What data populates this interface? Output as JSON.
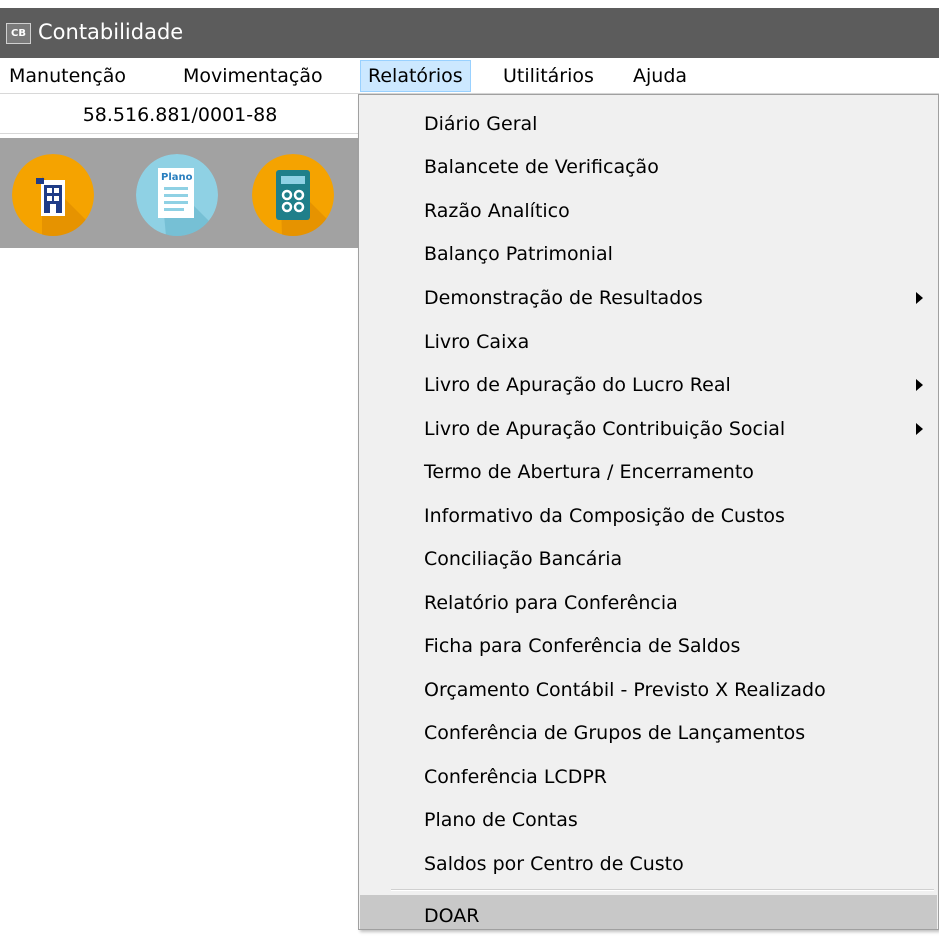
{
  "window": {
    "title": "Contabilidade",
    "icon_text": "CB"
  },
  "menubar": {
    "items": [
      "Manutenção",
      "Movimentação",
      "Relatórios",
      "Utilitários",
      "Ajuda"
    ],
    "active": "Relatórios"
  },
  "company": {
    "cnpj": "58.516.881/0001-88"
  },
  "toolbar": {
    "buttons": [
      {
        "icon": "building-icon",
        "accent": "#f5a300"
      },
      {
        "icon": "plano-document-icon",
        "label": "Plano",
        "accent": "#8fd1e4"
      },
      {
        "icon": "calculator-icon",
        "accent": "#f5a300"
      }
    ]
  },
  "relatorios_menu": {
    "items": [
      {
        "label": "Diário Geral"
      },
      {
        "label": "Balancete de Verificação"
      },
      {
        "label": "Razão Analítico"
      },
      {
        "label": "Balanço Patrimonial"
      },
      {
        "label": "Demonstração de Resultados",
        "submenu": true
      },
      {
        "label": "Livro Caixa"
      },
      {
        "label": "Livro de Apuração do Lucro Real",
        "submenu": true
      },
      {
        "label": "Livro de Apuração Contribuição Social",
        "submenu": true
      },
      {
        "label": "Termo de Abertura / Encerramento"
      },
      {
        "label": "Informativo da Composição de Custos"
      },
      {
        "label": "Conciliação Bancária"
      },
      {
        "label": "Relatório para Conferência"
      },
      {
        "label": "Ficha para Conferência de Saldos"
      },
      {
        "label": "Orçamento Contábil - Previsto X Realizado"
      },
      {
        "label": "Conferência de Grupos de Lançamentos"
      },
      {
        "label": "Conferência LCDPR"
      },
      {
        "label": "Plano de Contas"
      },
      {
        "label": "Saldos por Centro de Custo"
      },
      {
        "label": "DOAR",
        "highlighted": true
      }
    ]
  },
  "colors": {
    "titlebar": "#5c5c5c",
    "menu_active": "#cce8ff",
    "toolbar_bg": "#a2a2a2",
    "dropdown_bg": "#f0f0f0",
    "dropdown_highlight": "#c8c8c8"
  }
}
